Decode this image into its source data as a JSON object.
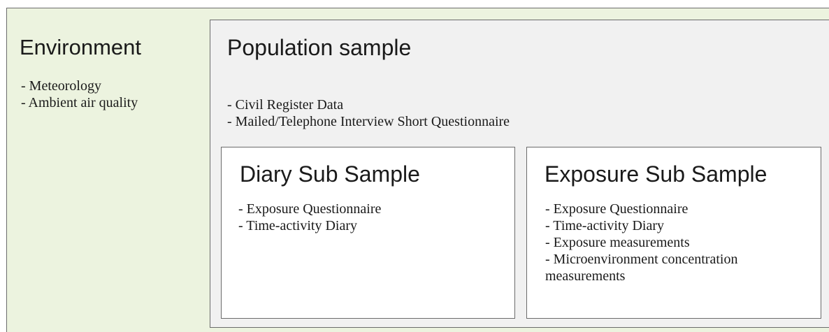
{
  "environment": {
    "title": "Environment",
    "items": [
      "- Meteorology",
      "- Ambient air quality"
    ]
  },
  "population": {
    "title": "Population sample",
    "items": [
      "- Civil Register Data",
      "- Mailed/Telephone Interview Short Questionnaire"
    ]
  },
  "diary": {
    "title": "Diary Sub Sample",
    "items": [
      "- Exposure Questionnaire",
      "- Time-activity Diary"
    ]
  },
  "exposure": {
    "title": "Exposure Sub Sample",
    "items": [
      "- Exposure Questionnaire",
      "- Time-activity Diary",
      "- Exposure measurements",
      "- Microenvironment concentration",
      "measurements"
    ]
  },
  "colors": {
    "environment_fill": "#ecf3df",
    "population_fill": "#f1f1f1",
    "subsample_fill": "#ffffff",
    "border": "#6b6b6b",
    "text": "#1a1a1a"
  }
}
